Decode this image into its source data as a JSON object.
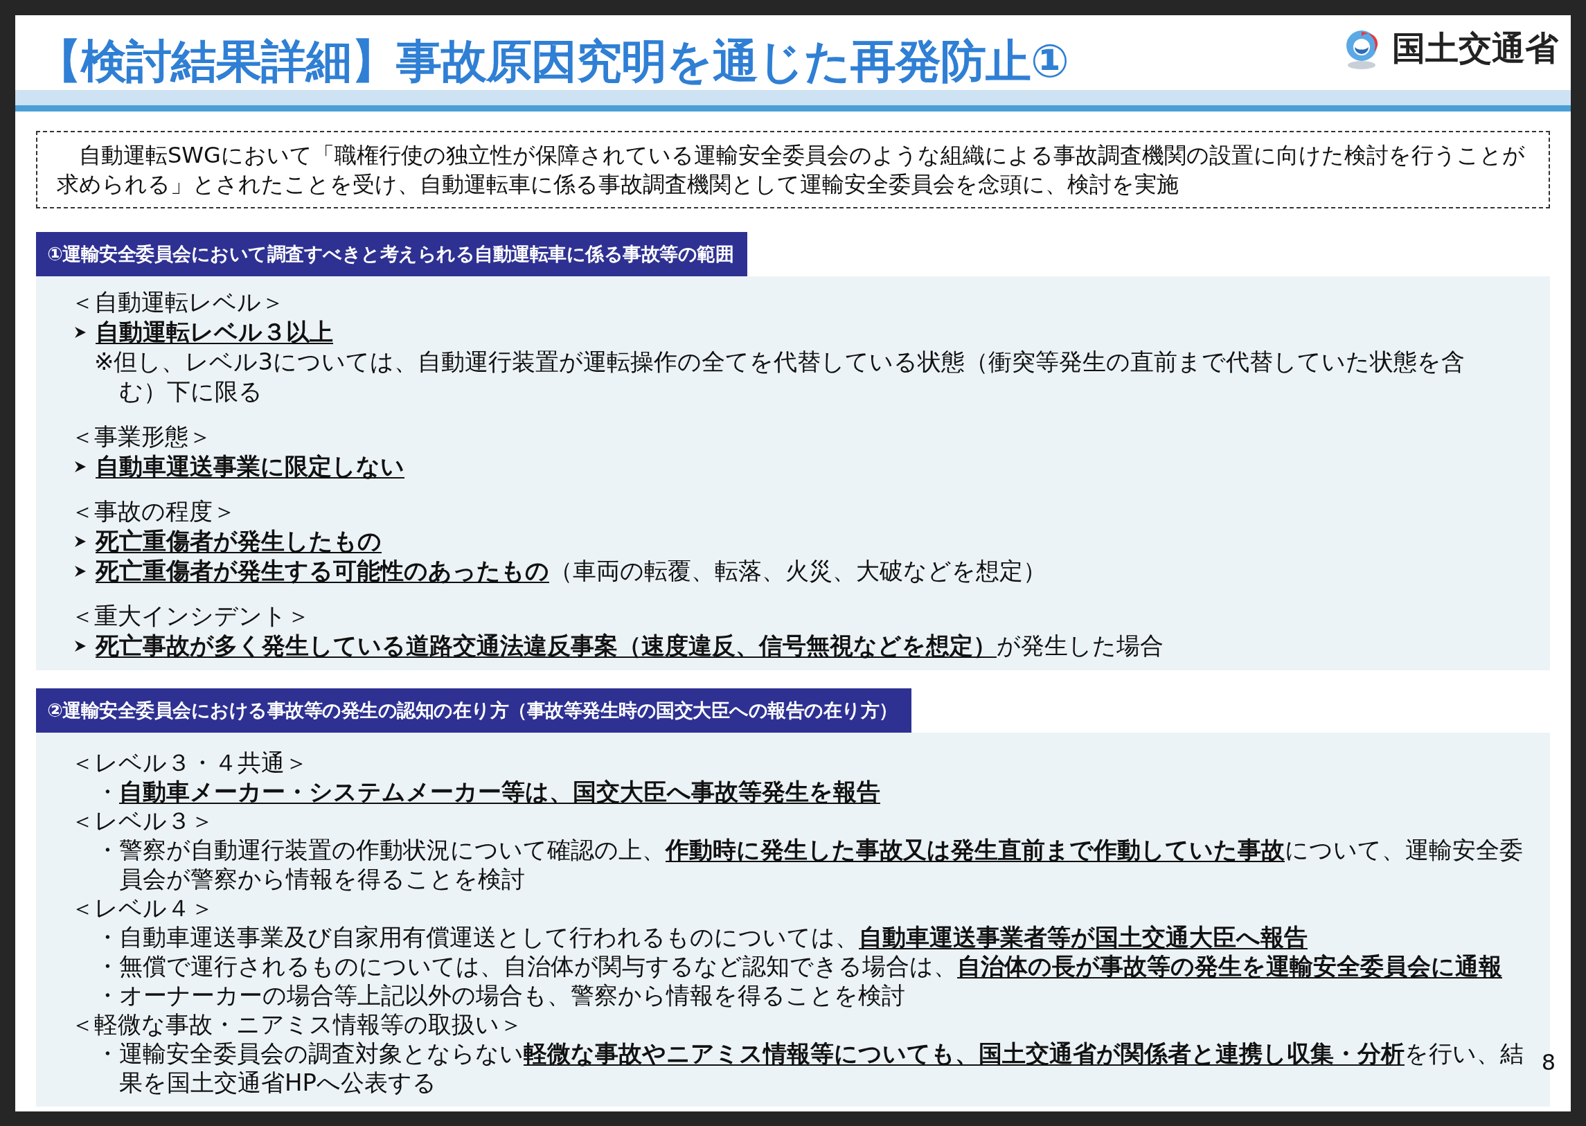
{
  "slide": {
    "title": "【検討結果詳細】事故原因究明を通じた再発防止①",
    "logo_text": "国土交通省",
    "page_number": "8",
    "intro": "自動運転SWGにおいて「職権行使の独立性が保障されている運輸安全委員会のような組織による事故調査機関の設置に向けた検討を行うことが求められる」とされたことを受け、自動運転車に係る事故調査機関として運輸安全委員会を念頭に、検討を実施",
    "sections": [
      {
        "header": "①運輸安全委員会において調査すべきと考えられる自動運転車に係る事故等の範囲",
        "groups": [
          {
            "heading": "＜自動運転レベル＞",
            "items": [
              {
                "kind": "arrow",
                "text": "**自動運転レベル３以上**"
              },
              {
                "kind": "note",
                "text": "※但し、レベル3については、自動運行装置が運転操作の全てを代替している状態（衝突等発生の直前まで代替していた状態を含む）下に限る"
              }
            ]
          },
          {
            "heading": "＜事業形態＞",
            "items": [
              {
                "kind": "arrow",
                "text": "**自動車運送事業に限定しない**"
              }
            ]
          },
          {
            "heading": "＜事故の程度＞",
            "items": [
              {
                "kind": "arrow",
                "text": "**死亡重傷者が発生したもの**"
              },
              {
                "kind": "arrow",
                "text": "**死亡重傷者が発生する可能性のあったもの**（車両の転覆、転落、火災、大破などを想定）"
              }
            ]
          },
          {
            "heading": "＜重大インシデント＞",
            "items": [
              {
                "kind": "arrow",
                "text": "**死亡事故が多く発生している道路交通法違反事案（速度違反、信号無視などを想定）**が発生した場合"
              }
            ]
          }
        ]
      },
      {
        "header": "②運輸安全委員会における事故等の発生の認知の在り方（事故等発生時の国交大臣への報告の在り方）",
        "groups": [
          {
            "heading": "＜レベル３・４共通＞",
            "items": [
              {
                "kind": "bullet",
                "text": "・**自動車メーカー・システムメーカー等は、国交大臣へ事故等発生を報告**"
              }
            ]
          },
          {
            "heading": "＜レベル３＞",
            "items": [
              {
                "kind": "bullet",
                "text": "・警察が自動運行装置の作動状況について確認の上、**作動時に発生した事故又は発生直前まで作動していた事故**について、運輸安全委員会が警察から情報を得ることを検討"
              }
            ]
          },
          {
            "heading": "＜レベル４＞",
            "items": [
              {
                "kind": "bullet",
                "text": "・自動車運送事業及び自家用有償運送として行われるものについては、**自動車運送事業者等が国土交通大臣へ報告**"
              },
              {
                "kind": "bullet",
                "text": "・無償で運行されるものについては、自治体が関与するなど認知できる場合は、**自治体の長が事故等の発生を運輸安全委員会に通報**"
              },
              {
                "kind": "bullet",
                "text": "・オーナーカーの場合等上記以外の場合も、警察から情報を得ることを検討"
              }
            ]
          },
          {
            "heading": "＜軽微な事故・ニアミス情報等の取扱い＞",
            "items": [
              {
                "kind": "bullet",
                "text": "・運輸安全委員会の調査対象とならない**軽微な事故やニアミス情報等についても、国土交通省が関係者と連携し収集・分析**を行い、結果を国土交通省HPへ公表する"
              }
            ]
          }
        ]
      }
    ]
  }
}
